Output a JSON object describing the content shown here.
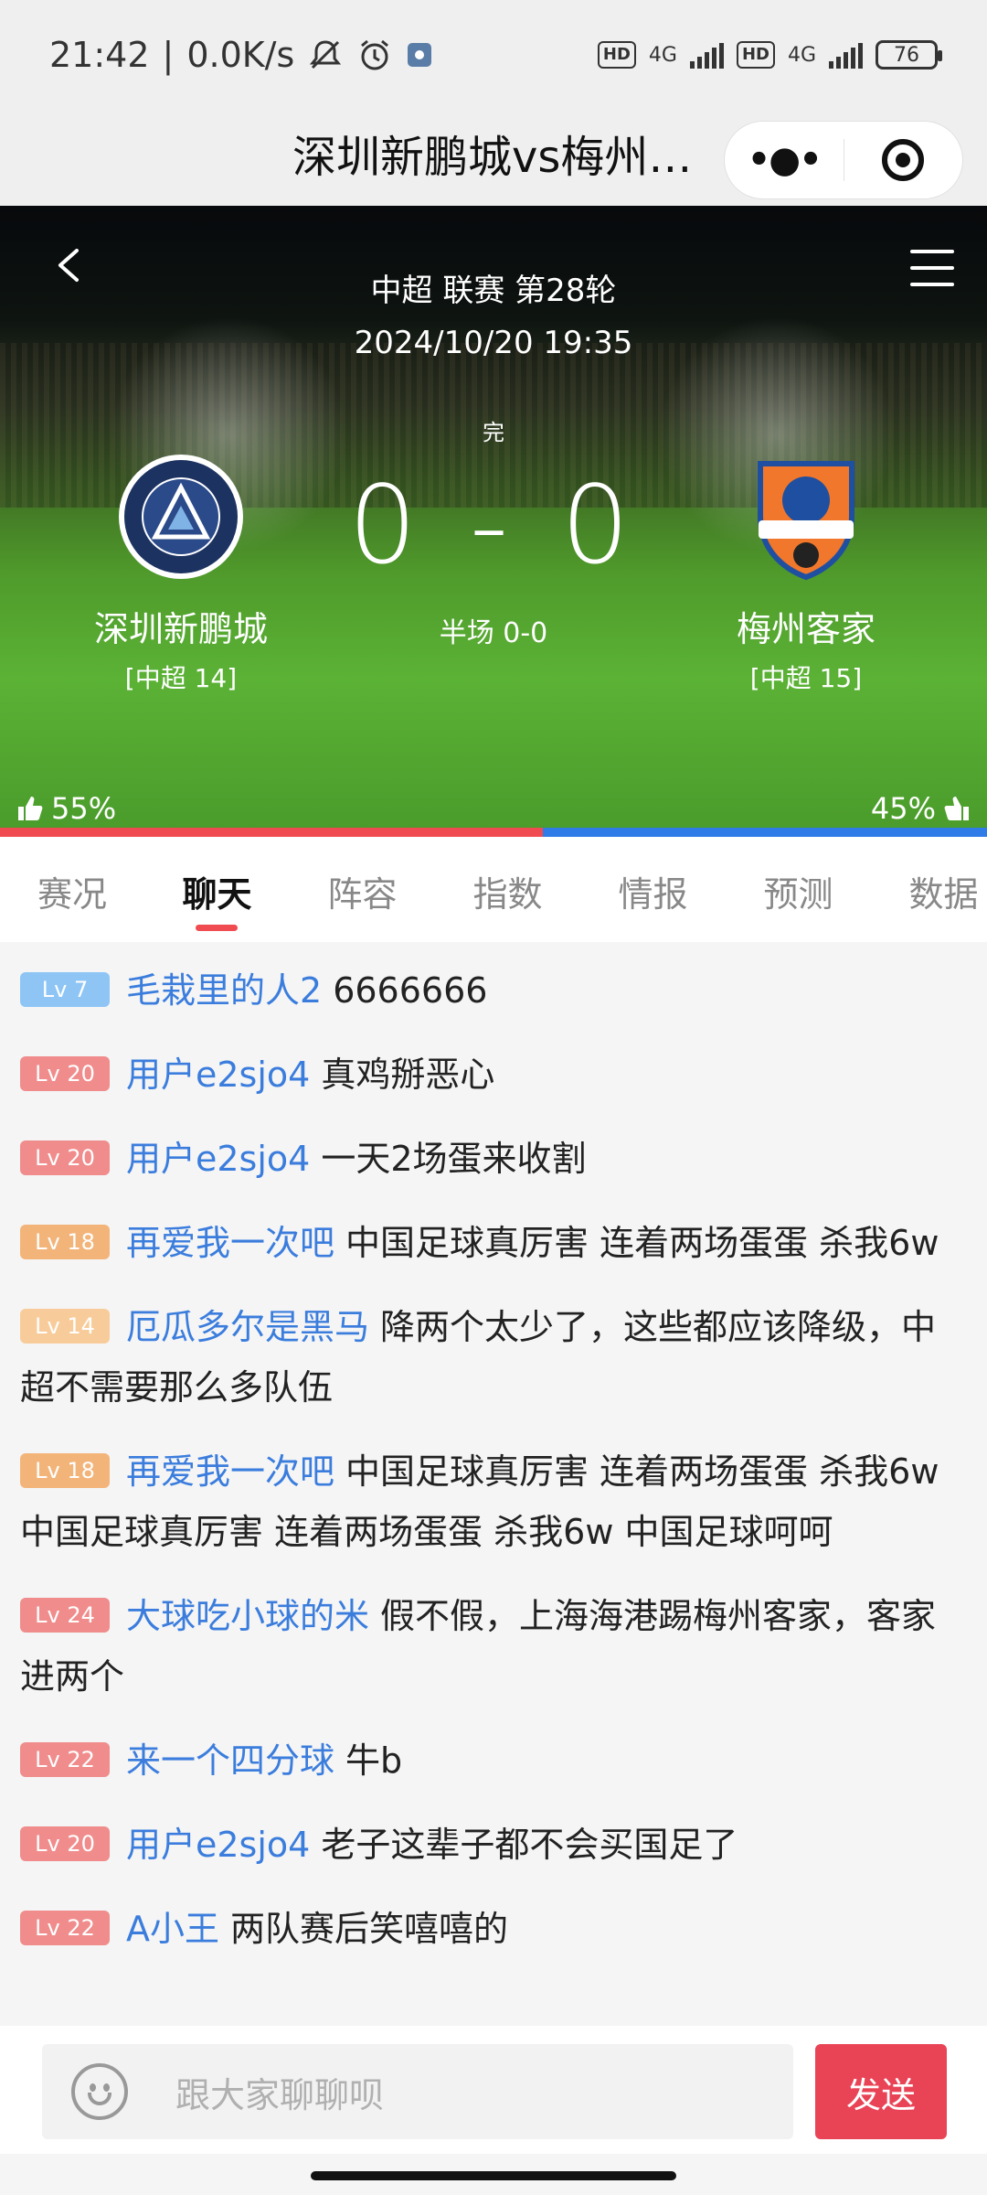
{
  "status_bar": {
    "time": "21:42",
    "net_speed": "0.0K/s",
    "hd1": "HD",
    "net1": "4G",
    "hd2": "HD",
    "net2": "4G",
    "battery": "76",
    "icons": [
      "mute-bell-icon",
      "alarm-icon",
      "settings-app-icon",
      "signal-icon",
      "battery-icon"
    ]
  },
  "titlebar": {
    "title": "深圳新鹏城vs梅州…"
  },
  "match": {
    "league_round": "中超 联赛 第28轮",
    "datetime": "2024/10/20 19:35",
    "status": "完",
    "score": "0 - 0",
    "half_time": "半场 0-0",
    "home": {
      "name": "深圳新鹏城",
      "rank": "[中超 14]",
      "support": "55%",
      "support_fraction": 0.55,
      "color": "#ef4b50"
    },
    "away": {
      "name": "梅州客家",
      "rank": "[中超 15]",
      "support": "45%",
      "color": "#2f7be8"
    }
  },
  "tabs": [
    {
      "label": "赛况",
      "active": false
    },
    {
      "label": "聊天",
      "active": true
    },
    {
      "label": "阵容",
      "active": false
    },
    {
      "label": "指数",
      "active": false
    },
    {
      "label": "情报",
      "active": false
    },
    {
      "label": "预测",
      "active": false
    },
    {
      "label": "数据",
      "active": false
    }
  ],
  "messages": [
    {
      "level": "Lv 7",
      "level_color": "#8ec5f5",
      "user": "毛栽里的人2",
      "text": "6666666"
    },
    {
      "level": "Lv 20",
      "level_color": "#f08c8c",
      "user": "用户e2sjo4",
      "text": "真鸡掰恶心"
    },
    {
      "level": "Lv 20",
      "level_color": "#f08c8c",
      "user": "用户e2sjo4",
      "text": "一天2场蛋来收割"
    },
    {
      "level": "Lv 18",
      "level_color": "#f3b47a",
      "user": "再爱我一次吧",
      "text": "中国足球真厉害 连着两场蛋蛋 杀我6w"
    },
    {
      "level": "Lv 14",
      "level_color": "#f8cc9a",
      "user": "厄瓜多尔是黑马",
      "text": "降两个太少了，这些都应该降级，中超不需要那么多队伍"
    },
    {
      "level": "Lv 18",
      "level_color": "#f3b47a",
      "user": "再爱我一次吧",
      "text": "中国足球真厉害 连着两场蛋蛋 杀我6w 中国足球真厉害 连着两场蛋蛋 杀我6w 中国足球呵呵"
    },
    {
      "level": "Lv 24",
      "level_color": "#f08c8c",
      "user": "大球吃小球的米",
      "text": "假不假，上海海港踢梅州客家，客家进两个"
    },
    {
      "level": "Lv 22",
      "level_color": "#f08c8c",
      "user": "来一个四分球",
      "text": "牛b"
    },
    {
      "level": "Lv 20",
      "level_color": "#f08c8c",
      "user": "用户e2sjo4",
      "text": "老子这辈子都不会买国足了"
    },
    {
      "level": "Lv 22",
      "level_color": "#f08c8c",
      "user": "A小王",
      "text": "两队赛后笑嘻嘻的"
    }
  ],
  "input": {
    "placeholder": "跟大家聊聊呗",
    "send_label": "发送"
  }
}
